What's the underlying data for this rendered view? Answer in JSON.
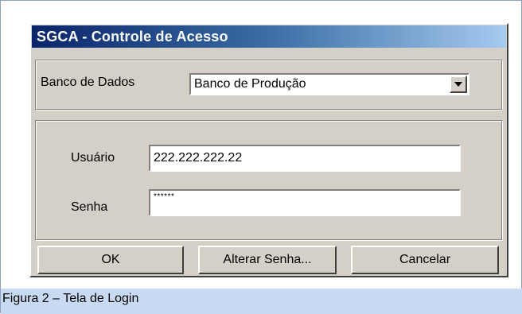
{
  "dialog": {
    "title": "SGCA - Controle de Acesso",
    "database_label": "Banco de Dados",
    "database_value": "Banco de Produção",
    "user_label": "Usuário",
    "user_value": "222.222.222.22",
    "password_label": "Senha",
    "password_value": "******",
    "buttons": {
      "ok": "OK",
      "change_password": "Alterar Senha...",
      "cancel": "Cancelar"
    }
  },
  "caption": "Figura 2 – Tela de Login"
}
